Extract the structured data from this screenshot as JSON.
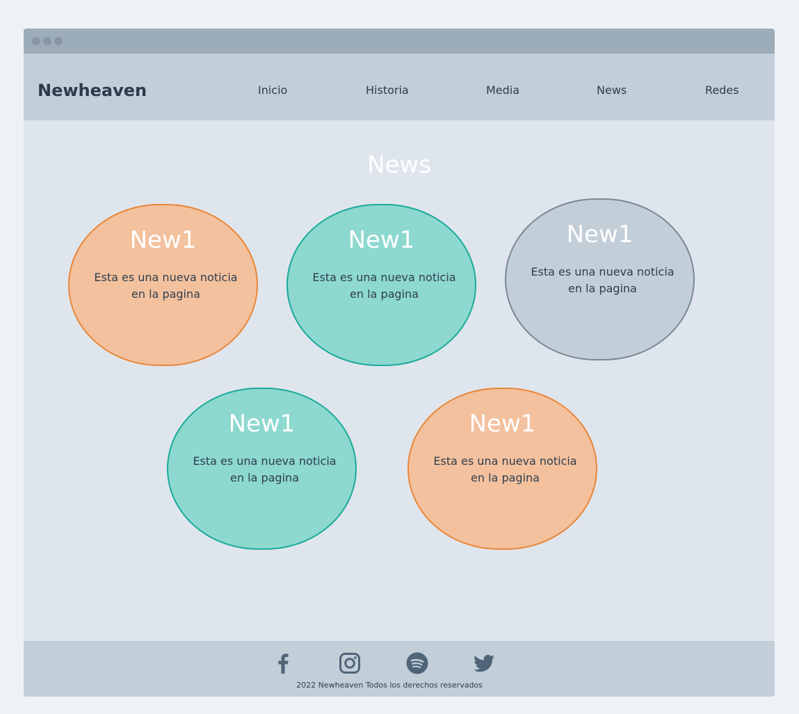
{
  "brand": "Newheaven",
  "nav": {
    "items": [
      {
        "label": "Inicio"
      },
      {
        "label": "Historia"
      },
      {
        "label": "Media"
      },
      {
        "label": "News"
      },
      {
        "label": "Redes"
      }
    ]
  },
  "main": {
    "title": "News",
    "cards": [
      {
        "title": "New1",
        "text": "Esta es una nueva noticia en la pagina",
        "color": "#f3c19e"
      },
      {
        "title": "New1",
        "text": "Esta es una nueva noticia en la pagina",
        "color": "#8dd8cf"
      },
      {
        "title": "New1",
        "text": "Esta es una nueva noticia en la pagina",
        "color": "#c2ced8"
      },
      {
        "title": "New1",
        "text": "Esta es una nueva noticia en la pagina",
        "color": "#8dd8cf"
      },
      {
        "title": "New1",
        "text": "Esta es una nueva noticia en la pagina",
        "color": "#f3c19e"
      }
    ]
  },
  "footer": {
    "social": [
      "facebook-icon",
      "instagram-icon",
      "spotify-icon",
      "twitter-icon"
    ],
    "copyright": "2022 Newheaven Todos los derechos reservados"
  },
  "colors": {
    "header_bg": "#c2ced8",
    "content_bg": "#dfe5ed",
    "titlebar_bg": "#9dacb9",
    "orange_border": "#e98637",
    "teal_border": "#1aaa9a",
    "icon_color": "#4f6577"
  }
}
